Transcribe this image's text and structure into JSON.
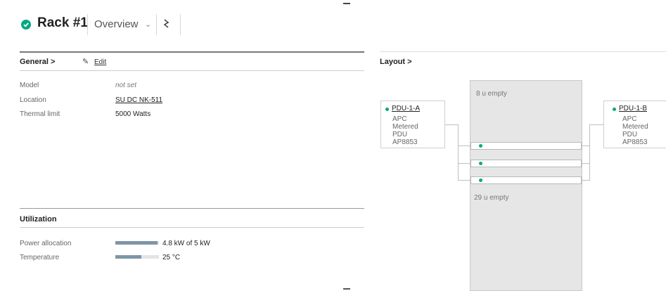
{
  "header": {
    "title": "Rack #1",
    "view": "Overview",
    "status_color": "#01a982",
    "icons": [
      "status-check-icon",
      "chevron-down-icon",
      "actions-icon"
    ]
  },
  "general": {
    "heading": "General >",
    "edit_label": "Edit",
    "fields": [
      {
        "label": "Model",
        "value": "not set"
      },
      {
        "label": "Location",
        "value": "SU DC NK-511"
      },
      {
        "label": "Thermal limit",
        "value": "5000 Watts"
      }
    ]
  },
  "utilization": {
    "heading": "Utilization",
    "rows": [
      {
        "label": "Power allocation",
        "value": "4.8 kW of 5 kW",
        "fraction": 0.96
      },
      {
        "label": "Temperature",
        "value": "25 °C",
        "fraction": 0.6
      }
    ]
  },
  "layout": {
    "heading": "Layout >",
    "top_empty": "8 u empty",
    "bottom_empty": "29 u empty",
    "pdus": [
      {
        "name": "PDU-1-A",
        "model": "APC Metered PDU AP8853"
      },
      {
        "name": "PDU-1-B",
        "model": "APC Metered PDU AP8853"
      }
    ],
    "device_count": 3
  }
}
